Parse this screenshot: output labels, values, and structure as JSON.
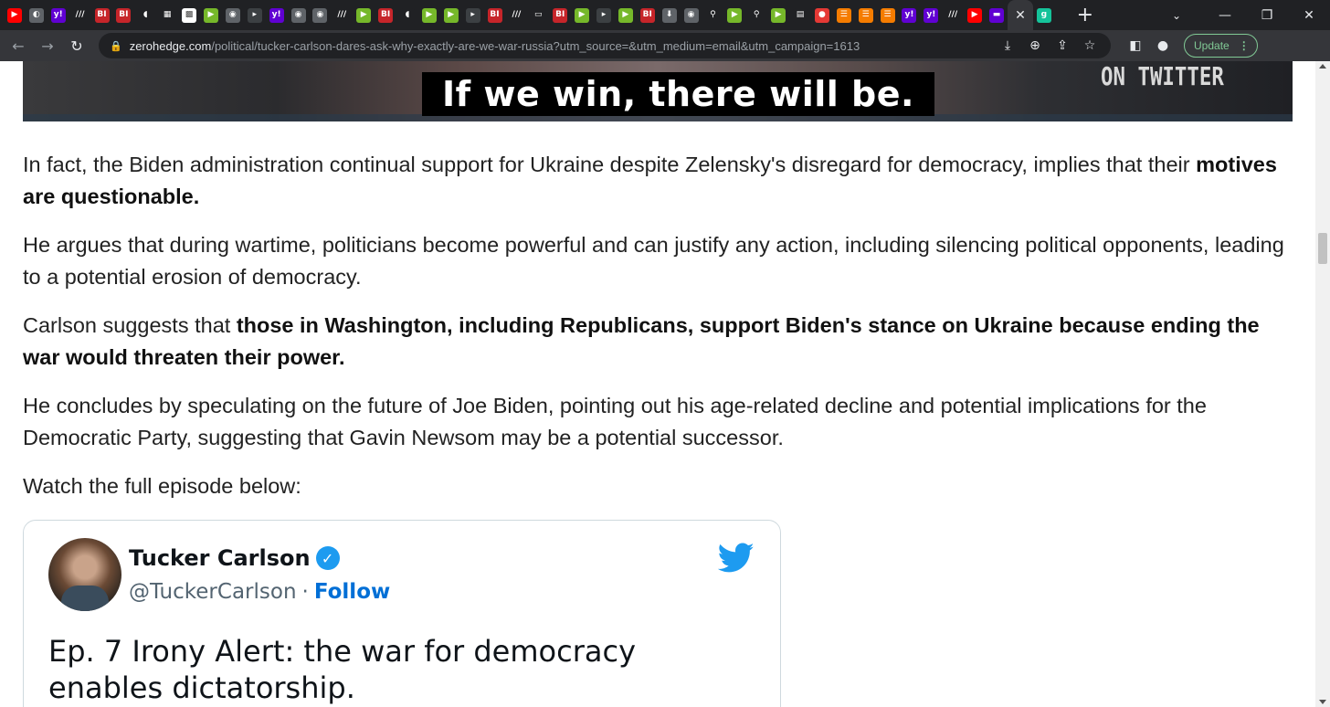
{
  "browser": {
    "tab_favicons": [
      {
        "icon": "youtube-icon",
        "glyph": "▶",
        "bg": "#ff0000"
      },
      {
        "icon": "shield-icon",
        "glyph": "◐",
        "bg": "#5f6368"
      },
      {
        "icon": "yahoo-icon",
        "glyph": "y!",
        "bg": "#6001d2"
      },
      {
        "icon": "slash-icon",
        "glyph": "///",
        "bg": "#202124"
      },
      {
        "icon": "business-insider-icon",
        "glyph": "BI",
        "bg": "#c6252a"
      },
      {
        "icon": "business-insider-icon",
        "glyph": "BI",
        "bg": "#c6252a"
      },
      {
        "icon": "shield-icon",
        "glyph": "◖",
        "bg": "#202124"
      },
      {
        "icon": "grid-icon",
        "glyph": "▦",
        "bg": "#202124"
      },
      {
        "icon": "puzzle-icon",
        "glyph": "▩",
        "bg": "#ffffff"
      },
      {
        "icon": "play-icon",
        "glyph": "▶",
        "bg": "#76b82a"
      },
      {
        "icon": "globe-icon",
        "glyph": "◉",
        "bg": "#5f6368"
      },
      {
        "icon": "arrow-icon",
        "glyph": "▸",
        "bg": "#3c4043"
      },
      {
        "icon": "yahoo-icon",
        "glyph": "y!",
        "bg": "#6001d2"
      },
      {
        "icon": "globe-icon",
        "glyph": "◉",
        "bg": "#5f6368"
      },
      {
        "icon": "globe-icon",
        "glyph": "◉",
        "bg": "#5f6368"
      },
      {
        "icon": "slash-icon",
        "glyph": "///",
        "bg": "#202124"
      },
      {
        "icon": "play-icon",
        "glyph": "▶",
        "bg": "#76b82a"
      },
      {
        "icon": "business-insider-icon",
        "glyph": "BI",
        "bg": "#c6252a"
      },
      {
        "icon": "shield-icon",
        "glyph": "◖",
        "bg": "#202124"
      },
      {
        "icon": "play-icon",
        "glyph": "▶",
        "bg": "#76b82a"
      },
      {
        "icon": "play-icon",
        "glyph": "▶",
        "bg": "#76b82a"
      },
      {
        "icon": "arrow-icon",
        "glyph": "▸",
        "bg": "#3c4043"
      },
      {
        "icon": "business-insider-icon",
        "glyph": "BI",
        "bg": "#c6252a"
      },
      {
        "icon": "slash-icon",
        "glyph": "///",
        "bg": "#202124"
      },
      {
        "icon": "blank-icon",
        "glyph": "▭",
        "bg": "#202124"
      },
      {
        "icon": "business-insider-icon",
        "glyph": "BI",
        "bg": "#c6252a"
      },
      {
        "icon": "play-icon",
        "glyph": "▶",
        "bg": "#76b82a"
      },
      {
        "icon": "arrow-icon",
        "glyph": "▸",
        "bg": "#3c4043"
      },
      {
        "icon": "play-icon",
        "glyph": "▶",
        "bg": "#76b82a"
      },
      {
        "icon": "business-insider-icon",
        "glyph": "BI",
        "bg": "#c6252a"
      },
      {
        "icon": "download-icon",
        "glyph": "⬇",
        "bg": "#5f6368"
      },
      {
        "icon": "globe-icon",
        "glyph": "◉",
        "bg": "#5f6368"
      },
      {
        "icon": "search-icon",
        "glyph": "⚲",
        "bg": "#202124"
      },
      {
        "icon": "play-icon",
        "glyph": "▶",
        "bg": "#76b82a"
      },
      {
        "icon": "search-icon",
        "glyph": "⚲",
        "bg": "#202124"
      },
      {
        "icon": "play-icon",
        "glyph": "▶",
        "bg": "#76b82a"
      },
      {
        "icon": "news-icon",
        "glyph": "▤",
        "bg": "#202124"
      },
      {
        "icon": "mic-icon",
        "glyph": "●",
        "bg": "#e53935"
      },
      {
        "icon": "bookmark-icon",
        "glyph": "☰",
        "bg": "#f57c00"
      },
      {
        "icon": "bookmark-icon",
        "glyph": "☰",
        "bg": "#f57c00"
      },
      {
        "icon": "bookmark-icon",
        "glyph": "☰",
        "bg": "#f57c00"
      },
      {
        "icon": "yahoo-icon",
        "glyph": "y!",
        "bg": "#6001d2"
      },
      {
        "icon": "yahoo-icon",
        "glyph": "y!",
        "bg": "#6001d2"
      },
      {
        "icon": "slash-icon",
        "glyph": "///",
        "bg": "#202124"
      },
      {
        "icon": "youtube-icon",
        "glyph": "▶",
        "bg": "#ff0000"
      },
      {
        "icon": "yahoo-mail-icon",
        "glyph": "▬",
        "bg": "#6001d2"
      }
    ],
    "active_tab": {
      "icon": "close-icon",
      "glyph": "✕"
    },
    "extra_tab": {
      "icon": "grammarly-icon",
      "glyph": "g",
      "bg": "#15c39a"
    },
    "new_tab_glyph": "+",
    "window": {
      "chevron": "⌄",
      "minimize": "—",
      "maximize": "❐",
      "close": "✕"
    },
    "nav": {
      "back": "←",
      "forward": "→",
      "reload": "↻"
    },
    "address": {
      "lock": "🔒",
      "host": "zerohedge.com",
      "path": "/political/tucker-carlson-dares-ask-why-exactly-are-we-war-russia?utm_source=&utm_medium=email&utm_campaign=1613"
    },
    "omnibox_icons": {
      "install": "⤓",
      "zoom": "⊕",
      "share": "⇪",
      "star": "☆"
    },
    "toolbar_icons": {
      "sidepanel": "◧",
      "profile": "●"
    },
    "update": {
      "label": "Update",
      "menu": "⋮"
    }
  },
  "video": {
    "caption": "If we win, there will be.",
    "watermark": "ON TWITTER"
  },
  "article": {
    "p1": {
      "text": "In fact, the Biden administration continual support for Ukraine despite Zelensky's disregard for democracy, implies that their ",
      "bold": "motives are questionable."
    },
    "p2": {
      "text": "He argues that during wartime, politicians become powerful and can justify any action, including silencing political opponents, leading to a potential erosion of democracy."
    },
    "p3": {
      "text": "Carlson suggests that ",
      "bold": "those in Washington, including Republicans, support Biden's stance on Ukraine because ending the war would threaten their power."
    },
    "p4": {
      "text": "He concludes by speculating on the future of Joe Biden, pointing out his age-related decline and potential implications for the Democratic Party, suggesting that Gavin Newsom may be a potential successor."
    },
    "p5": {
      "text": "Watch the full episode below:"
    }
  },
  "tweet": {
    "name": "Tucker Carlson",
    "verified_glyph": "✓",
    "handle": "@TuckerCarlson",
    "separator": "·",
    "follow": "Follow",
    "text": "Ep. 7  Irony Alert: the war for democracy enables dictatorship.",
    "colors": {
      "twitter_blue": "#1d9bf0",
      "follow_blue": "#006fd6"
    }
  }
}
